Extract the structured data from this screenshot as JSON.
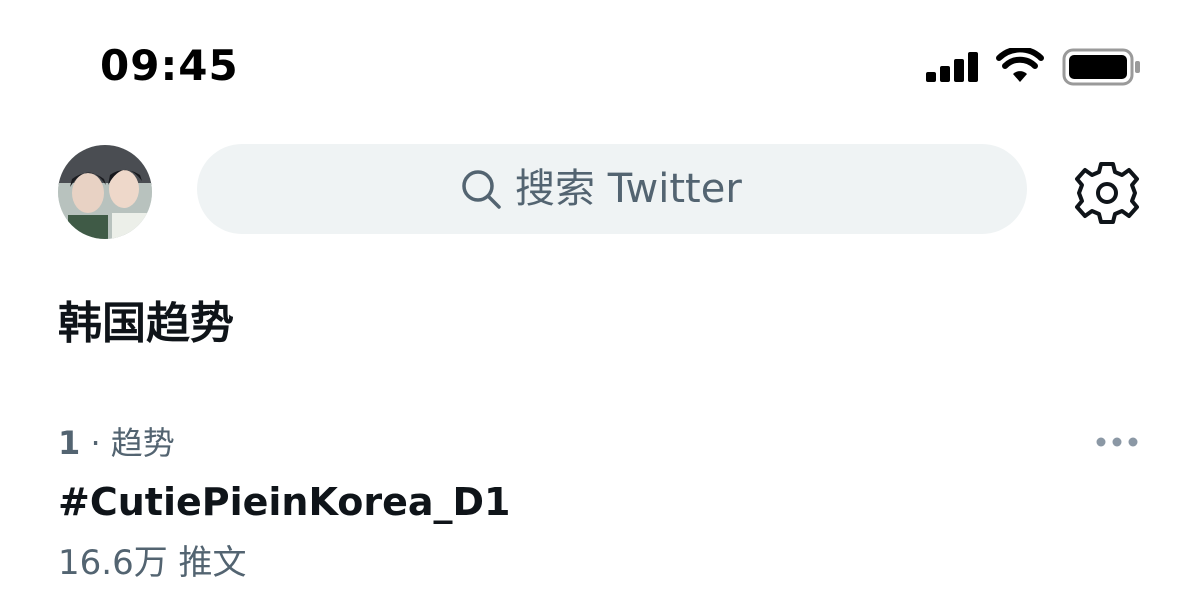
{
  "status_bar": {
    "time": "09:45",
    "icons": [
      "cellular-signal-icon",
      "wifi-icon",
      "battery-icon"
    ]
  },
  "header": {
    "avatar": "profile-avatar",
    "search": {
      "placeholder": "搜索 Twitter",
      "icon": "search-icon"
    },
    "settings_icon": "gear-icon"
  },
  "section": {
    "title": "韩国趋势"
  },
  "trends": [
    {
      "rank": "1",
      "separator": " · ",
      "category": "趋势",
      "name": "#CutiePieinKorea_D1",
      "count": "16.6万 推文",
      "more_icon": "more-dots-icon"
    }
  ],
  "colors": {
    "text_primary": "#0f1419",
    "text_secondary": "#536471",
    "search_bg": "#eff3f4",
    "background": "#ffffff"
  }
}
